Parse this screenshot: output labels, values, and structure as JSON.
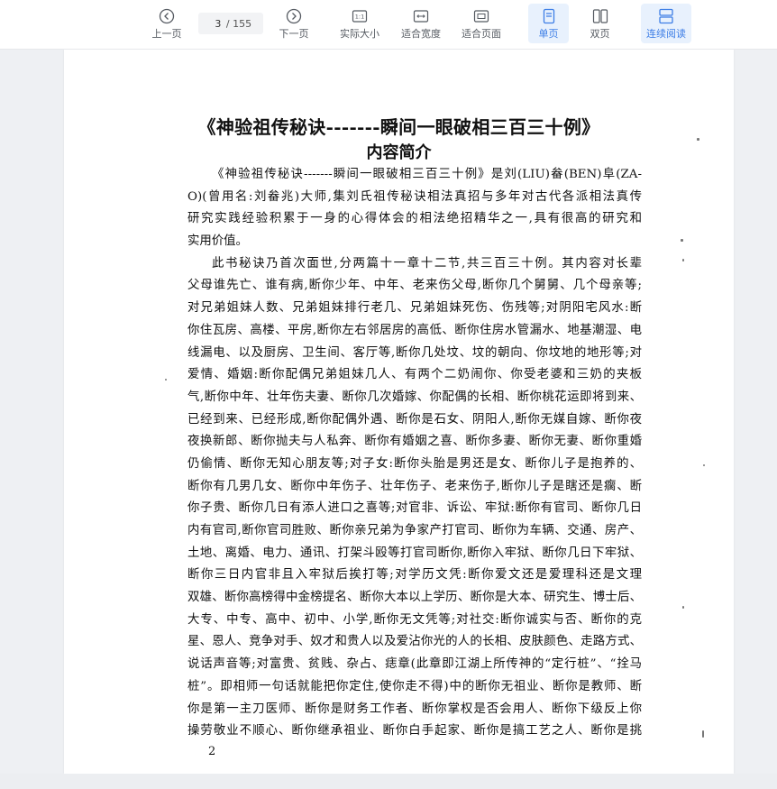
{
  "toolbar": {
    "prev_page": "上一页",
    "current_page": "3",
    "total_pages": "/ 155",
    "next_page": "下一页",
    "actual_size": "实际大小",
    "fit_width": "适合宽度",
    "fit_page": "适合页面",
    "single_page": "单页",
    "double_page": "双页",
    "continuous": "连续阅读"
  },
  "document": {
    "title": "《神验祖传秘诀-------瞬间一眼破相三百三十例》",
    "subtitle": "内容简介",
    "lines": [
      "《神验祖传秘诀-------瞬间一眼破相三百三十例》是刘(LIU)畚(BEN)阜(ZA-",
      "O)(曾用名:刘畚兆)大师,集刘氏祖传秘诀相法真招与多年对古代各派相法真传",
      "研究实践经验积累于一身的心得体会的相法绝招精华之一,具有很高的研究和",
      "实用价值。",
      "此书秘诀乃首次面世,分两篇十一章十二节,共三百三十例。其内容对长辈",
      "父母谁先亡、谁有病,断你少年、中年、老来伤父母,断你几个舅舅、几个母亲等;",
      "对兄弟姐妹人数、兄弟姐妹排行老几、兄弟姐妹死伤、伤残等;对阴阳宅风水:断",
      "你住瓦房、高楼、平房,断你左右邻居房的高低、断你住房水管漏水、地基潮湿、电",
      "线漏电、以及厨房、卫生间、客厅等,断你几处坟、坟的朝向、你坟地的地形等;对",
      "爱情、婚姻:断你配偶兄弟姐妹几人、有两个二奶闹你、你受老婆和三奶的夹板",
      "气,断你中年、壮年伤夫妻、断你几次婚嫁、你配偶的长相、断你桃花运即将到来、",
      "已经到来、已经形成,断你配偶外遇、断你是石女、阴阳人,断你无媒自嫁、断你夜",
      "夜换新郎、断你抛夫与人私奔、断你有婚姻之喜、断你多妻、断你无妻、断你重婚",
      "仍偷情、断你无知心朋友等;对子女:断你头胎是男还是女、断你儿子是抱养的、",
      "断你有几男几女、断你中年伤子、壮年伤子、老来伤子,断你儿子是瞎还是瘸、断",
      "你子贵、断你几日有添人进口之喜等;对官非、诉讼、牢狱:断你有官司、断你几日",
      "内有官司,断你官司胜败、断你亲兄弟为争家产打官司、断你为车辆、交通、房产、",
      "土地、离婚、电力、通讯、打架斗殴等打官司断你,断你入牢狱、断你几日下牢狱、",
      "断你三日内官非且入牢狱后挨打等;对学历文凭:断你爱文还是爱理科还是文理",
      "双雄、断你高榜得中金榜提名、断你大本以上学历、断你是大本、研究生、博士后、",
      "大专、中专、高中、初中、小学,断你无文凭等;对社交:断你诚实与否、断你的克",
      "星、恩人、竞争对手、奴才和贵人以及爱沾你光的人的长相、皮肤颜色、走路方式、",
      "说话声音等;对富贵、贫贱、杂占、痣章(此章即江湖上所传神的“定行桩”、“拴马",
      "桩”。即相师一句话就能把你定住,使你走不得)中的断你无祖业、断你是教师、断",
      "你是第一主刀医师、断你是财务工作者、断你掌权是否会用人、断你下级反上你",
      "操劳敬业不顺心、断你继承祖业、断你白手起家、断你是搞工艺之人、断你是挑"
    ],
    "page_number": "2"
  }
}
